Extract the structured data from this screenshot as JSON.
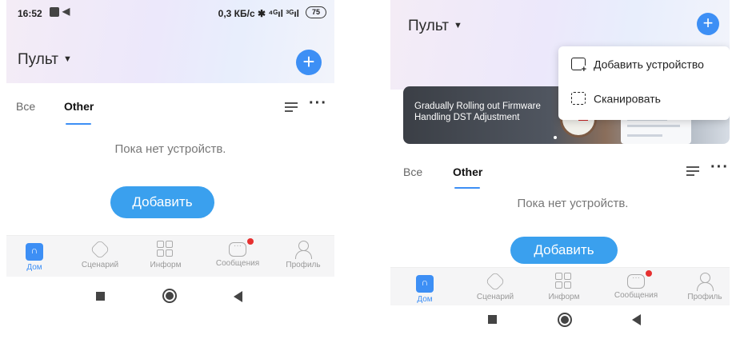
{
  "left": {
    "status": {
      "time": "16:52",
      "network": "0,3 КБ/с ✱ ⁴ᴳıl ³ᴳıl",
      "battery": "75"
    },
    "header": {
      "title": "Пульт",
      "add_icon": "plus-icon"
    },
    "tabs": [
      {
        "label": "Все"
      },
      {
        "label": "Other"
      }
    ],
    "empty_text": "Пока нет устройств.",
    "add_button": "Добавить",
    "nav": [
      {
        "label": "Дом",
        "icon": "home-icon"
      },
      {
        "label": "Сценарий",
        "icon": "scene-icon"
      },
      {
        "label": "Информ",
        "icon": "grid-icon"
      },
      {
        "label": "Сообщения",
        "icon": "message-icon"
      },
      {
        "label": "Профиль",
        "icon": "profile-icon"
      }
    ]
  },
  "right": {
    "header": {
      "title": "Пульт",
      "add_icon": "plus-icon"
    },
    "popup": {
      "items": [
        {
          "label": "Добавить устройство",
          "icon": "add-device-icon"
        },
        {
          "label": "Сканировать",
          "icon": "scan-icon"
        }
      ]
    },
    "banner": {
      "text": "Gradually Rolling out Firmware Handling DST Adjustment"
    },
    "tabs": [
      {
        "label": "Все"
      },
      {
        "label": "Other"
      }
    ],
    "empty_text": "Пока нет устройств.",
    "add_button": "Добавить",
    "nav": [
      {
        "label": "Дом",
        "icon": "home-icon"
      },
      {
        "label": "Сценарий",
        "icon": "scene-icon"
      },
      {
        "label": "Информ",
        "icon": "grid-icon"
      },
      {
        "label": "Сообщения",
        "icon": "message-icon"
      },
      {
        "label": "Профиль",
        "icon": "profile-icon"
      }
    ]
  },
  "colors": {
    "accent": "#3d8ff5",
    "button": "#3aa0ee",
    "notification": "#e63030"
  }
}
